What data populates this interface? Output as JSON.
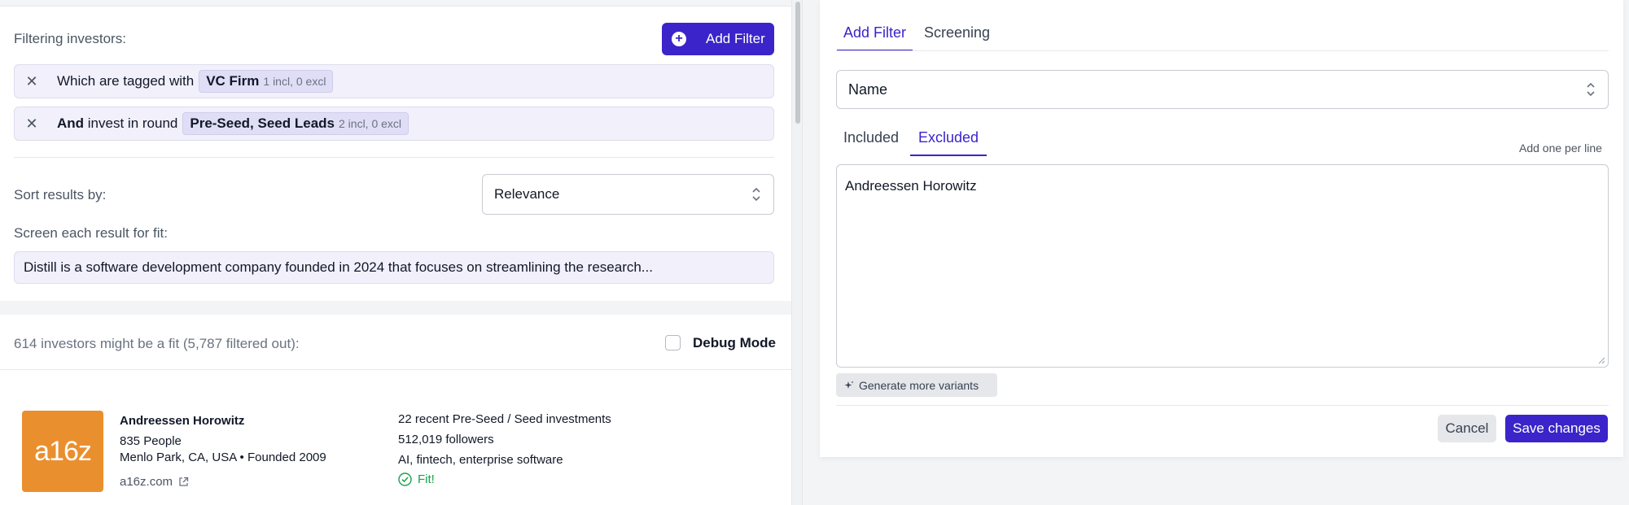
{
  "colors": {
    "accent": "#3b24c9",
    "chip_bg": "#e0def7",
    "fit_green": "#16a34a",
    "logo_orange": "#ea8f2e"
  },
  "filters": {
    "label": "Filtering investors:",
    "add_button": "Add Filter",
    "add_button_icon": "plus-circle-icon",
    "rows": [
      {
        "remove_icon": "close-icon",
        "prefix_bold": "",
        "text": "Which are tagged with",
        "chip_label": "VC Firm",
        "chip_count": "1 incl, 0 excl"
      },
      {
        "remove_icon": "close-icon",
        "prefix_bold": "And",
        "text": "invest in round",
        "chip_label": "Pre-Seed, Seed Leads",
        "chip_count": "2 incl, 0 excl"
      }
    ]
  },
  "sort": {
    "label": "Sort results by:",
    "value": "Relevance"
  },
  "screen": {
    "label": "Screen each result for fit:",
    "value": "Distill is a software development company founded in 2024 that focuses on streamlining the research..."
  },
  "results": {
    "summary": "614 investors might be a fit (5,787 filtered out):",
    "debug_label": "Debug Mode",
    "debug_checked": false
  },
  "investor": {
    "logo_text": "a16z",
    "name": "Andreessen Horowitz",
    "people": "835 People",
    "location": "Menlo Park, CA, USA • Founded 2009",
    "website": "a16z.com",
    "recent": "22 recent Pre-Seed / Seed investments",
    "followers": "512,019 followers",
    "sectors": "AI, fintech, enterprise software",
    "fit": "Fit!"
  },
  "panel": {
    "tabs": [
      "Add Filter",
      "Screening"
    ],
    "active_tab": "Add Filter",
    "field_select": "Name",
    "subtabs": [
      "Included",
      "Excluded"
    ],
    "active_subtab": "Excluded",
    "hint": "Add one per line",
    "textarea_value": "Andreessen Horowitz",
    "generate_button": "Generate more variants",
    "cancel_button": "Cancel",
    "save_button": "Save changes"
  }
}
